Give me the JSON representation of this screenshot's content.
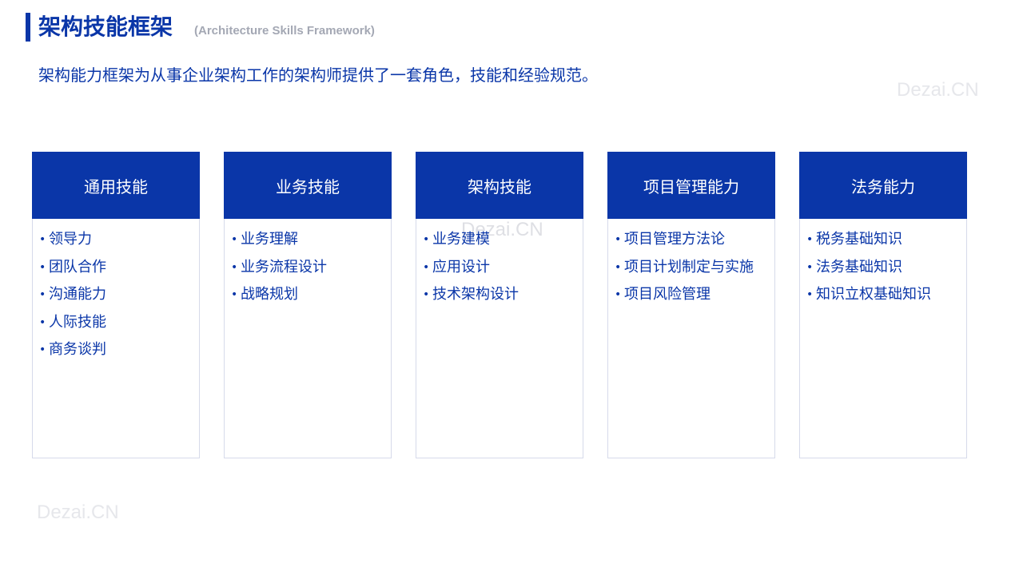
{
  "header": {
    "title": "架构技能框架",
    "subtitle": "(Architecture  Skills Framework)",
    "accent_color": "#0a36a8"
  },
  "intro": "架构能力框架为从事企业架构工作的架构师提供了一套角色，技能和经验规范。",
  "watermark": "Dezai.CN",
  "columns": [
    {
      "title": "通用技能",
      "items": [
        "领导力",
        "团队合作",
        "沟通能力",
        "人际技能",
        "商务谈判"
      ]
    },
    {
      "title": "业务技能",
      "items": [
        "业务理解",
        "业务流程设计",
        "战略规划"
      ]
    },
    {
      "title": "架构技能",
      "items": [
        "业务建模",
        "应用设计",
        "技术架构设计"
      ]
    },
    {
      "title": "项目管理能力",
      "items": [
        "项目管理方法论",
        "项目计划制定与实施",
        "项目风险管理"
      ]
    },
    {
      "title": "法务能力",
      "items": [
        "税务基础知识",
        "法务基础知识",
        "知识立权基础知识"
      ]
    }
  ]
}
